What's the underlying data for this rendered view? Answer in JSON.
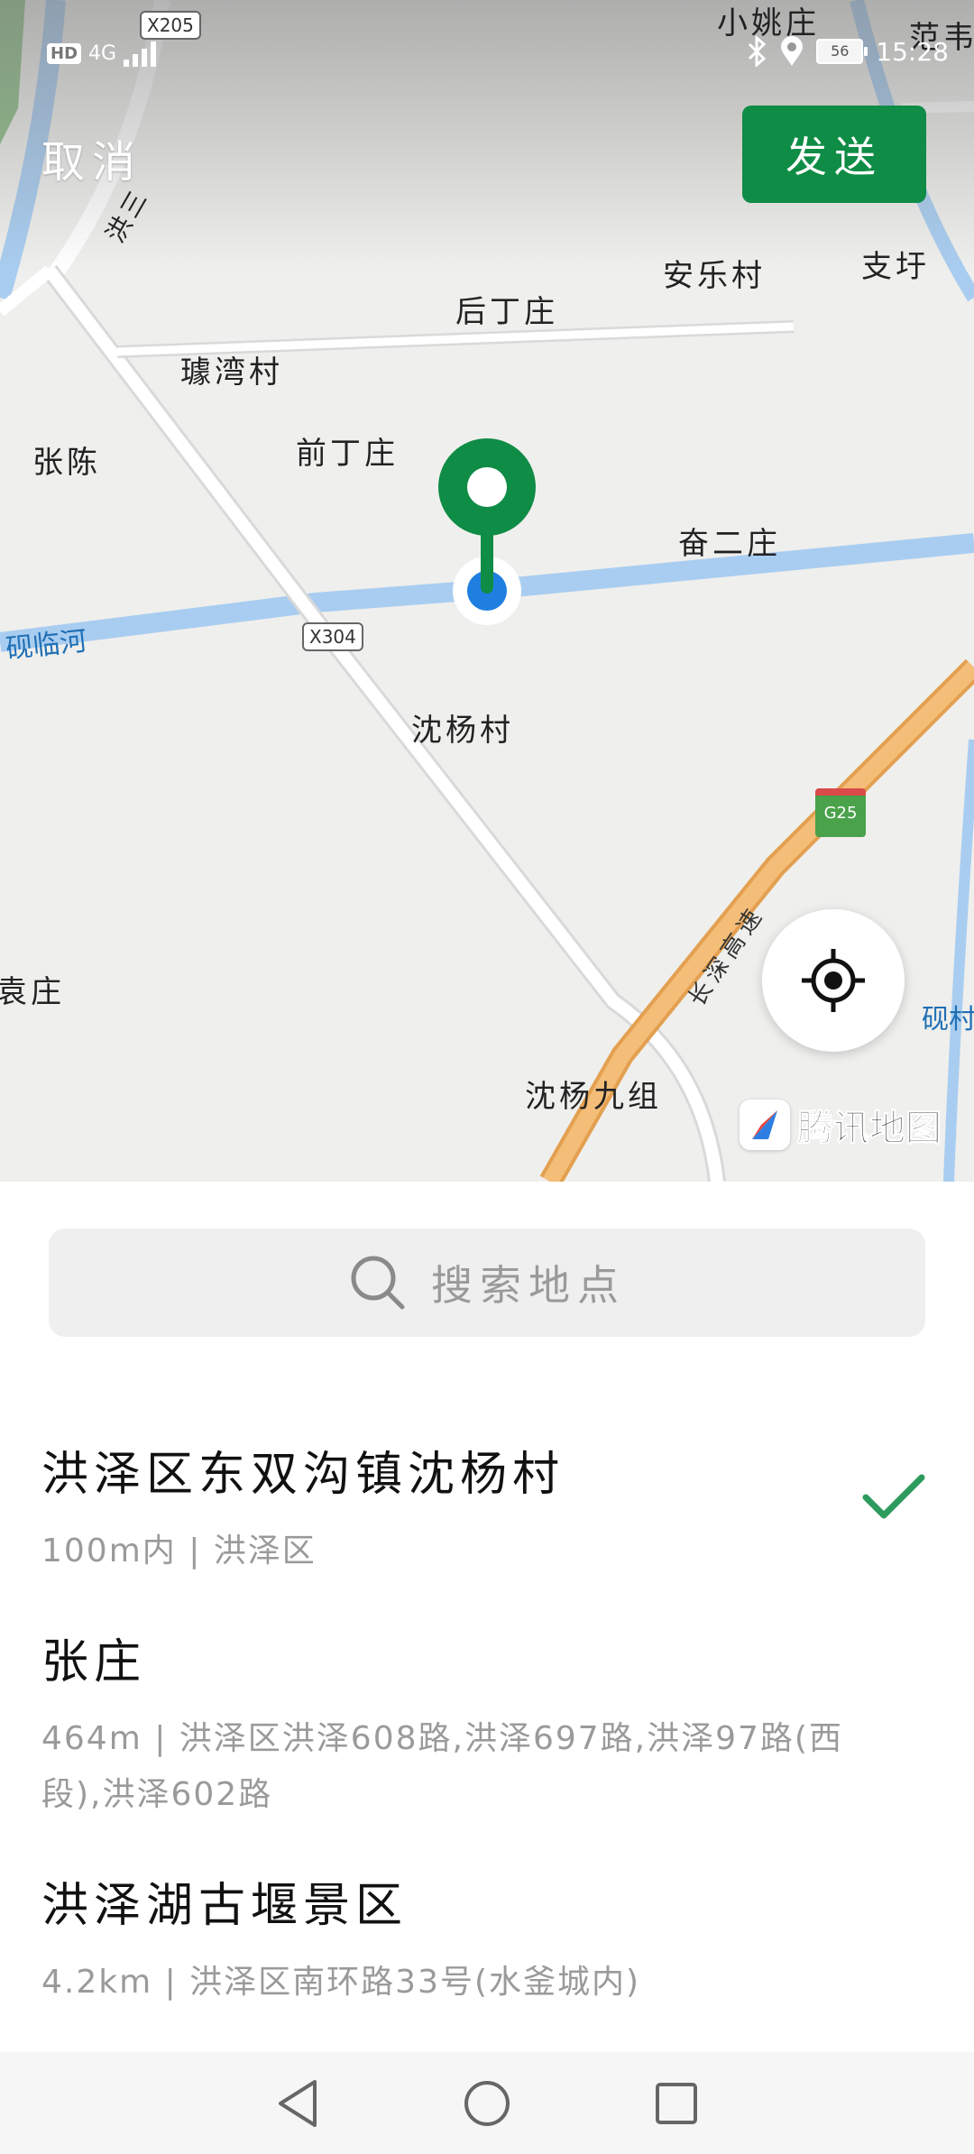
{
  "status_bar": {
    "hd_label": "HD",
    "network_label": "4G",
    "battery_level": "56",
    "time": "15:28"
  },
  "header": {
    "cancel_label": "取消",
    "send_label": "发送"
  },
  "map": {
    "places": [
      "小姚庄",
      "范韦",
      "安乐村",
      "支圩",
      "后丁庄",
      "璩湾村",
      "张陈",
      "前丁庄",
      "奋二庄",
      "沈杨村",
      "袁庄",
      "沈杨九组",
      "洪三"
    ],
    "water_labels": [
      "砚临河",
      "砚村"
    ],
    "road_shields": [
      "X205",
      "X304"
    ],
    "highway_shield": "G25",
    "highway_label": "长深高速",
    "brand": "腾讯地图"
  },
  "search": {
    "placeholder": "搜索地点"
  },
  "results": [
    {
      "name": "洪泽区东双沟镇沈杨村",
      "detail": "100m内 | 洪泽区",
      "selected": true
    },
    {
      "name": "张庄",
      "detail": "464m | 洪泽区洪泽608路,洪泽697路,洪泽97路(西段),洪泽602路",
      "selected": false
    },
    {
      "name": "洪泽湖古堰景区",
      "detail": "4.2km | 洪泽区南环路33号(水釜城内)",
      "selected": false
    }
  ],
  "colors": {
    "accent": "#0f8c45",
    "check": "#2e9b5e",
    "water": "#a9cdf0",
    "highway": "#f2b46a"
  },
  "nav": {
    "back_icon": "back-triangle-icon",
    "home_icon": "home-circle-icon",
    "recents_icon": "recents-square-icon"
  }
}
